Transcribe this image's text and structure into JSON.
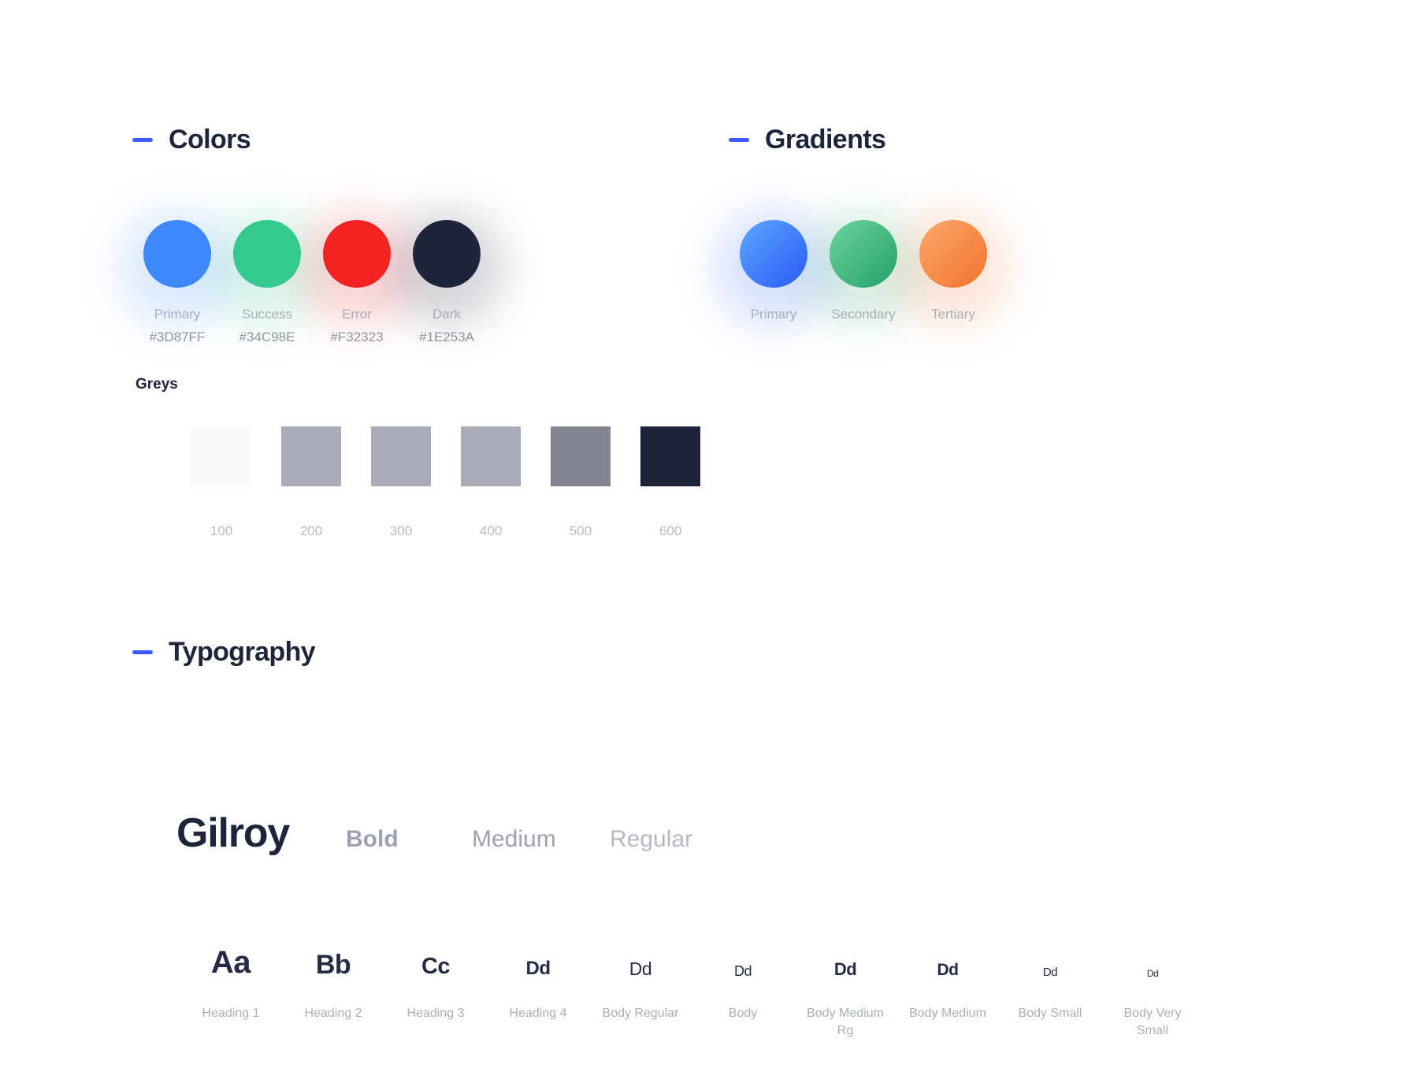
{
  "colors": {
    "heading": "Colors",
    "swatches": [
      {
        "name": "Primary",
        "hex": "#3D87FF"
      },
      {
        "name": "Success",
        "hex": "#34C98E"
      },
      {
        "name": "Error",
        "hex": "#F32323"
      },
      {
        "name": "Dark",
        "hex": "#1E253A"
      }
    ]
  },
  "gradients": {
    "heading": "Gradients",
    "swatches": [
      {
        "name": "Primary",
        "from": "#5BA7FF",
        "to": "#2B5BF5"
      },
      {
        "name": "Secondary",
        "from": "#6CD49A",
        "to": "#25A06B"
      },
      {
        "name": "Tertiary",
        "from": "#FBA86A",
        "to": "#F2732E"
      }
    ]
  },
  "greys": {
    "label": "Greys",
    "steps": [
      {
        "num": "100",
        "hex": "#FAFAFB"
      },
      {
        "num": "200",
        "hex": "#A8ACB6"
      },
      {
        "num": "300",
        "hex": "#A8ACB6"
      },
      {
        "num": "400",
        "hex": "#A8ACB6"
      },
      {
        "num": "500",
        "hex": "#80848F"
      },
      {
        "num": "600",
        "hex": "#1E253A"
      }
    ]
  },
  "typography": {
    "heading": "Typography",
    "font_name": "Gilroy",
    "weights": [
      "Bold",
      "Medium",
      "Regular"
    ],
    "scale": [
      {
        "glyph": "Aa",
        "label": "Heading 1",
        "size": 40,
        "weight": "bold"
      },
      {
        "glyph": "Bb",
        "label": "Heading 2",
        "size": 34,
        "weight": "bold"
      },
      {
        "glyph": "Cc",
        "label": "Heading 3",
        "size": 29,
        "weight": "bold"
      },
      {
        "glyph": "Dd",
        "label": "Heading 4",
        "size": 24,
        "weight": "bold"
      },
      {
        "glyph": "Dd",
        "label": "Body Regular",
        "size": 23,
        "weight": "normal"
      },
      {
        "glyph": "Dd",
        "label": "Body",
        "size": 18,
        "weight": "normal"
      },
      {
        "glyph": "Dd",
        "label": "Body Medium Rg",
        "size": 22,
        "weight": "bold"
      },
      {
        "glyph": "Dd",
        "label": "Body Medium",
        "size": 21,
        "weight": "bold"
      },
      {
        "glyph": "Dd",
        "label": "Body Small",
        "size": 15,
        "weight": "normal"
      },
      {
        "glyph": "Dd",
        "label": "Body Very Small",
        "size": 12,
        "weight": "normal"
      }
    ]
  },
  "accent": {
    "dash_color": "#3D5AFE",
    "heading_color": "#1E253A"
  }
}
